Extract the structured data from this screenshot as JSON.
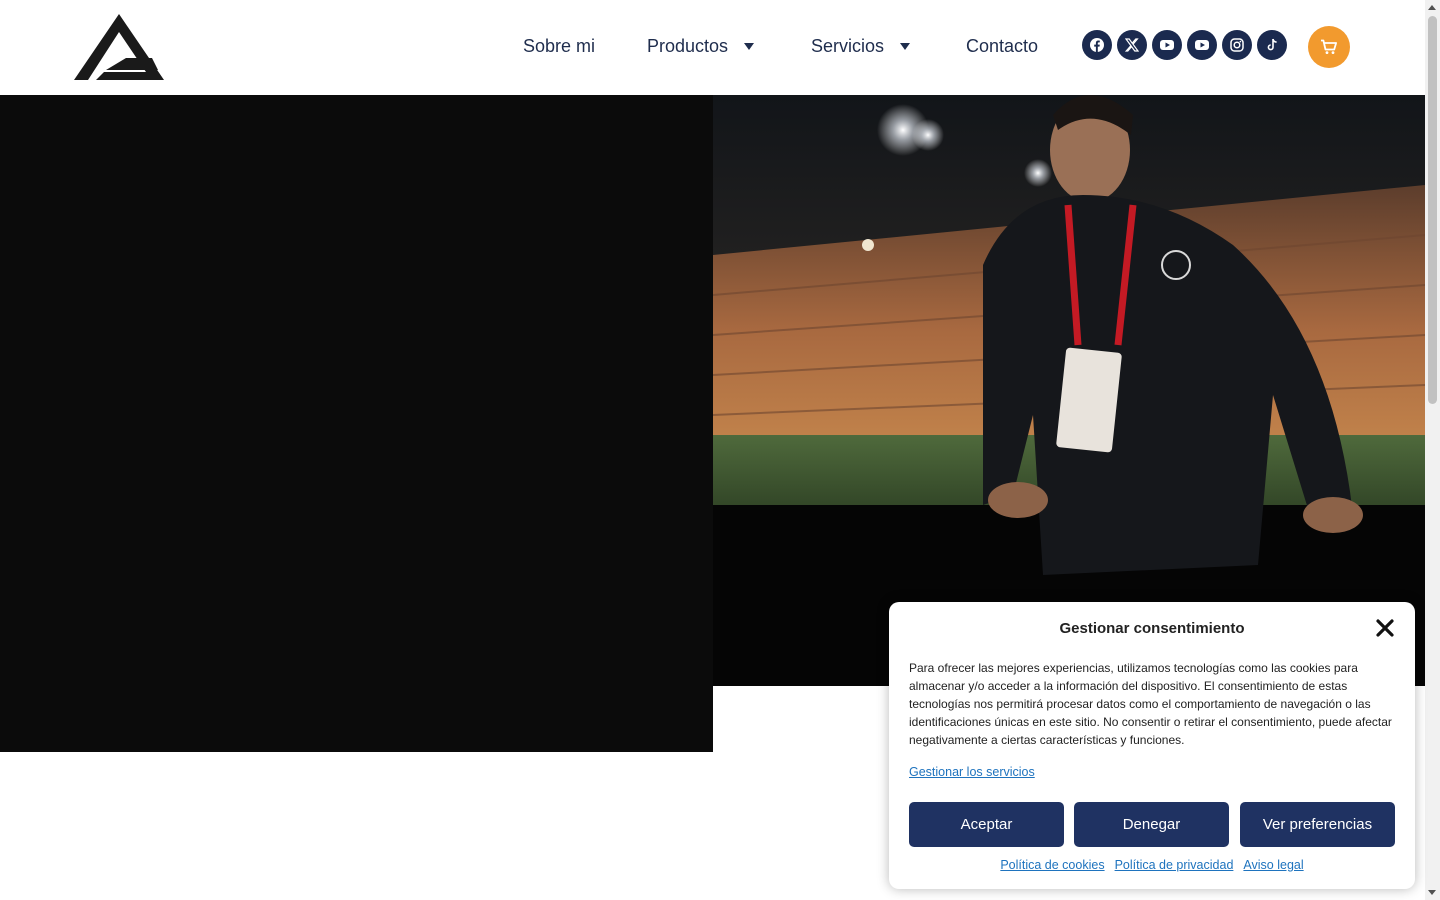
{
  "header": {
    "logo_icon": "brand-triangle-logo",
    "nav": [
      {
        "label": "Sobre mi",
        "has_dropdown": false
      },
      {
        "label": "Productos",
        "has_dropdown": true
      },
      {
        "label": "Servicios",
        "has_dropdown": true
      },
      {
        "label": "Contacto",
        "has_dropdown": false
      }
    ],
    "socials": [
      "facebook-icon",
      "x-twitter-icon",
      "youtube-icon",
      "youtube-icon",
      "instagram-icon",
      "tiktok-icon"
    ],
    "cart_icon": "cart-icon",
    "colors": {
      "nav_text": "#1f2d4d",
      "social_bg": "#1b2a4f",
      "cart_bg": "#f29a2e"
    }
  },
  "hero": {
    "left_color": "#0b0b0b",
    "photo": "man-in-stadium-wearing-accreditation-lanyard"
  },
  "consent": {
    "title": "Gestionar consentimiento",
    "text": "Para ofrecer las mejores experiencias, utilizamos tecnologías como las cookies para almacenar y/o acceder a la información del dispositivo. El consentimiento de estas tecnologías nos permitirá procesar datos como el comportamiento de navegación o las identificaciones únicas en este sitio. No consentir o retirar el consentimiento, puede afectar negativamente a ciertas características y funciones.",
    "manage_link": "Gestionar los servicios",
    "buttons": {
      "accept": "Aceptar",
      "deny": "Denegar",
      "preferences": "Ver preferencias"
    },
    "links": {
      "cookies": "Política de cookies",
      "privacy": "Política de privacidad",
      "legal": "Aviso legal"
    },
    "colors": {
      "button_bg": "#1f3262",
      "link": "#1e73be"
    }
  }
}
